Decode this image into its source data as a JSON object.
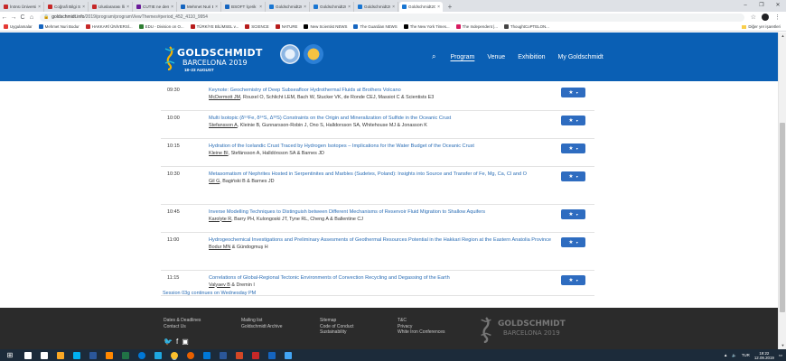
{
  "browser": {
    "tabs": [
      {
        "label": "İnönü Üniversitesi | A",
        "color": "#c62828"
      },
      {
        "label": "Coğrafi Bilgi Sistemleri",
        "color": "#c62828"
      },
      {
        "label": "Uluslararası İlişkiler",
        "color": "#c62828"
      },
      {
        "label": "CUTIE ne demek - ",
        "color": "#6a1b9a"
      },
      {
        "label": "Mehmet Nuri Bodur",
        "color": "#1565c0"
      },
      {
        "label": "BSOFT İçerik Yönetim",
        "color": "#1565c0"
      },
      {
        "label": "Goldschmidt2019: ",
        "color": "#1976d2"
      },
      {
        "label": "Goldschmidt2019: ",
        "color": "#1976d2"
      },
      {
        "label": "Goldschmidt2019: ",
        "color": "#1976d2"
      },
      {
        "label": "Goldschmidt2019: ",
        "color": "#1976d2"
      }
    ],
    "new_tab": "+",
    "window_controls": {
      "minimize": "–",
      "restore": "❐",
      "close": "✕"
    },
    "url_host": "goldschmidt.info",
    "url_path": "/2019/program/programViewThemes#period_452_4110_9954",
    "nav": {
      "back": "←",
      "forward": "→",
      "reload": "C",
      "home": "⌂"
    },
    "bookmarks": [
      {
        "label": "Uygulamalar",
        "color": "#e53935"
      },
      {
        "label": "Mehmet Nuri Bodur",
        "color": "#1565c0"
      },
      {
        "label": "HAKKARİ ÜNİVERSİ...",
        "color": "#c62828"
      },
      {
        "label": "EDU - Division on O...",
        "color": "#2e7d32"
      },
      {
        "label": "TÜRKİYE BİLİMSEL v...",
        "color": "#b71c1c"
      },
      {
        "label": "SCIENCE",
        "color": "#b71c1c"
      },
      {
        "label": "NATURE",
        "color": "#b71c1c"
      },
      {
        "label": "New Scientist NEWS",
        "color": "#000000"
      },
      {
        "label": "The Guardian NEWS",
        "color": "#1565c0"
      },
      {
        "label": "The New York Times...",
        "color": "#000000"
      },
      {
        "label": "The Independent |...",
        "color": "#d81b60"
      },
      {
        "label": "ThoughtCoPTELON...",
        "color": "#444444"
      }
    ],
    "other_bookmarks": "Diğer yer işaretleri"
  },
  "site": {
    "logo_title": "GOLDSCHMIDT",
    "logo_city": "BARCELONA 2019",
    "logo_dates": "18–23 AUGUST",
    "nav": {
      "search_icon": "⌕",
      "items": [
        "Program",
        "Venue",
        "Exhibition",
        "My Goldschmidt"
      ]
    }
  },
  "program": {
    "rows": [
      {
        "time": "09:30",
        "keynote_prefix": "Keynote: ",
        "title": "Geochemistry of Deep Subseafloor Hydrothermal Fluids at Brothers Volcano",
        "presenter": "McDermott JM",
        "authors": ", Rouxel O, Schlicht LEM, Bach W, Stucker VK, de Ronde CEJ, Massiot C & Scientists E3"
      },
      {
        "time": "10:00",
        "keynote_prefix": "",
        "title": "Multi Isotopic (δ⁵⁶Fe, δ³⁴S, Δ³³S) Constraints on the Origin and Mineralization of Sulfide in the Oceanic Crust",
        "presenter": "Stefansson A",
        "authors": ", Kleinie B, Gunnarsson-Robin J, Ono S, Halldorsson SA, Whitehouse MJ & Jonasson K"
      },
      {
        "time": "10:15",
        "keynote_prefix": "",
        "title": "Hydration of the Icelandic Crust Traced by Hydrogen Isotopes – Implications for the Water Budget of the Oceanic Crust",
        "presenter": "Kleine BI",
        "authors": ", Stefánsson A, Halldórsson SA & Barnes JD"
      },
      {
        "time": "10:30",
        "keynote_prefix": "",
        "title": "Metasomatism of Nephrites Hosted in Serpentinites and Marbles (Sudetes, Poland): Insights into Source and Transfer of Fe, Mg, Ca, Cl and O",
        "presenter": "Gil G",
        "authors": ", Bagiński B & Barnes JD"
      },
      {
        "time": "10:45",
        "keynote_prefix": "",
        "title": "Inverse Modelling Techniques to Distinguish between Different Mechanisms of Reservoir Fluid Migration to Shallow Aquifers",
        "presenter": "Karolyte R",
        "authors": ", Barry PH, Kulongoski JT, Tyne RL, Cheng A & Ballentine CJ"
      },
      {
        "time": "11:00",
        "keynote_prefix": "",
        "title": "Hydrogeochemical Investigations and Preliminary Assesments of Geothermal Resources Potential in the Hakkari Region at the Eastern Anatolia Province",
        "presenter": "Bodur MN",
        "authors": " & Gündogmuş H"
      },
      {
        "time": "11:15",
        "keynote_prefix": "",
        "title": "Correlations of Global-Regional Tectonic Environments of Convection Recycling and Degassing of the Earth",
        "presenter": "Valyaev B",
        "authors": " & Dremin I"
      }
    ],
    "fav_icon": "★",
    "fav_caret": "▾",
    "session_note": "Session 03g continues on Wednesday PM"
  },
  "footer": {
    "col1": [
      "Dates & Deadlines",
      "Contact Us"
    ],
    "col2": [
      "Mailing list",
      "Goldschmidt Archive"
    ],
    "col3": [
      "Sitemap",
      "Code of Conduct",
      "Sustainability"
    ],
    "col4": [
      "T&C",
      "Privacy",
      "White Iron Conferences"
    ],
    "social": [
      "🐦",
      "f",
      "▣"
    ],
    "logo_title": "GOLDSCHMIDT",
    "logo_city": "BARCELONA 2019"
  },
  "taskbar": {
    "start": "⊞",
    "icons": [
      {
        "name": "search",
        "color": "#ffffff"
      },
      {
        "name": "task-view",
        "color": "#ffffff"
      },
      {
        "name": "files",
        "color": "#f9a825"
      },
      {
        "name": "skype",
        "color": "#00aff0"
      },
      {
        "name": "word",
        "color": "#2b579a"
      },
      {
        "name": "vlc",
        "color": "#ff8800"
      },
      {
        "name": "excel",
        "color": "#217346"
      },
      {
        "name": "edge",
        "color": "#0078d7"
      },
      {
        "name": "ie",
        "color": "#1ea7e1"
      },
      {
        "name": "chrome",
        "color": "#fbc02d"
      },
      {
        "name": "firefox",
        "color": "#e66000"
      },
      {
        "name": "store",
        "color": "#0078d7"
      },
      {
        "name": "word2",
        "color": "#2b579a"
      },
      {
        "name": "powerpoint",
        "color": "#d24726"
      },
      {
        "name": "app-red",
        "color": "#c62828"
      },
      {
        "name": "app-blue",
        "color": "#1565c0"
      },
      {
        "name": "app-a",
        "color": "#42a5f5"
      }
    ],
    "lang": "TUR",
    "time": "19:22",
    "date": "12.09.2019"
  }
}
